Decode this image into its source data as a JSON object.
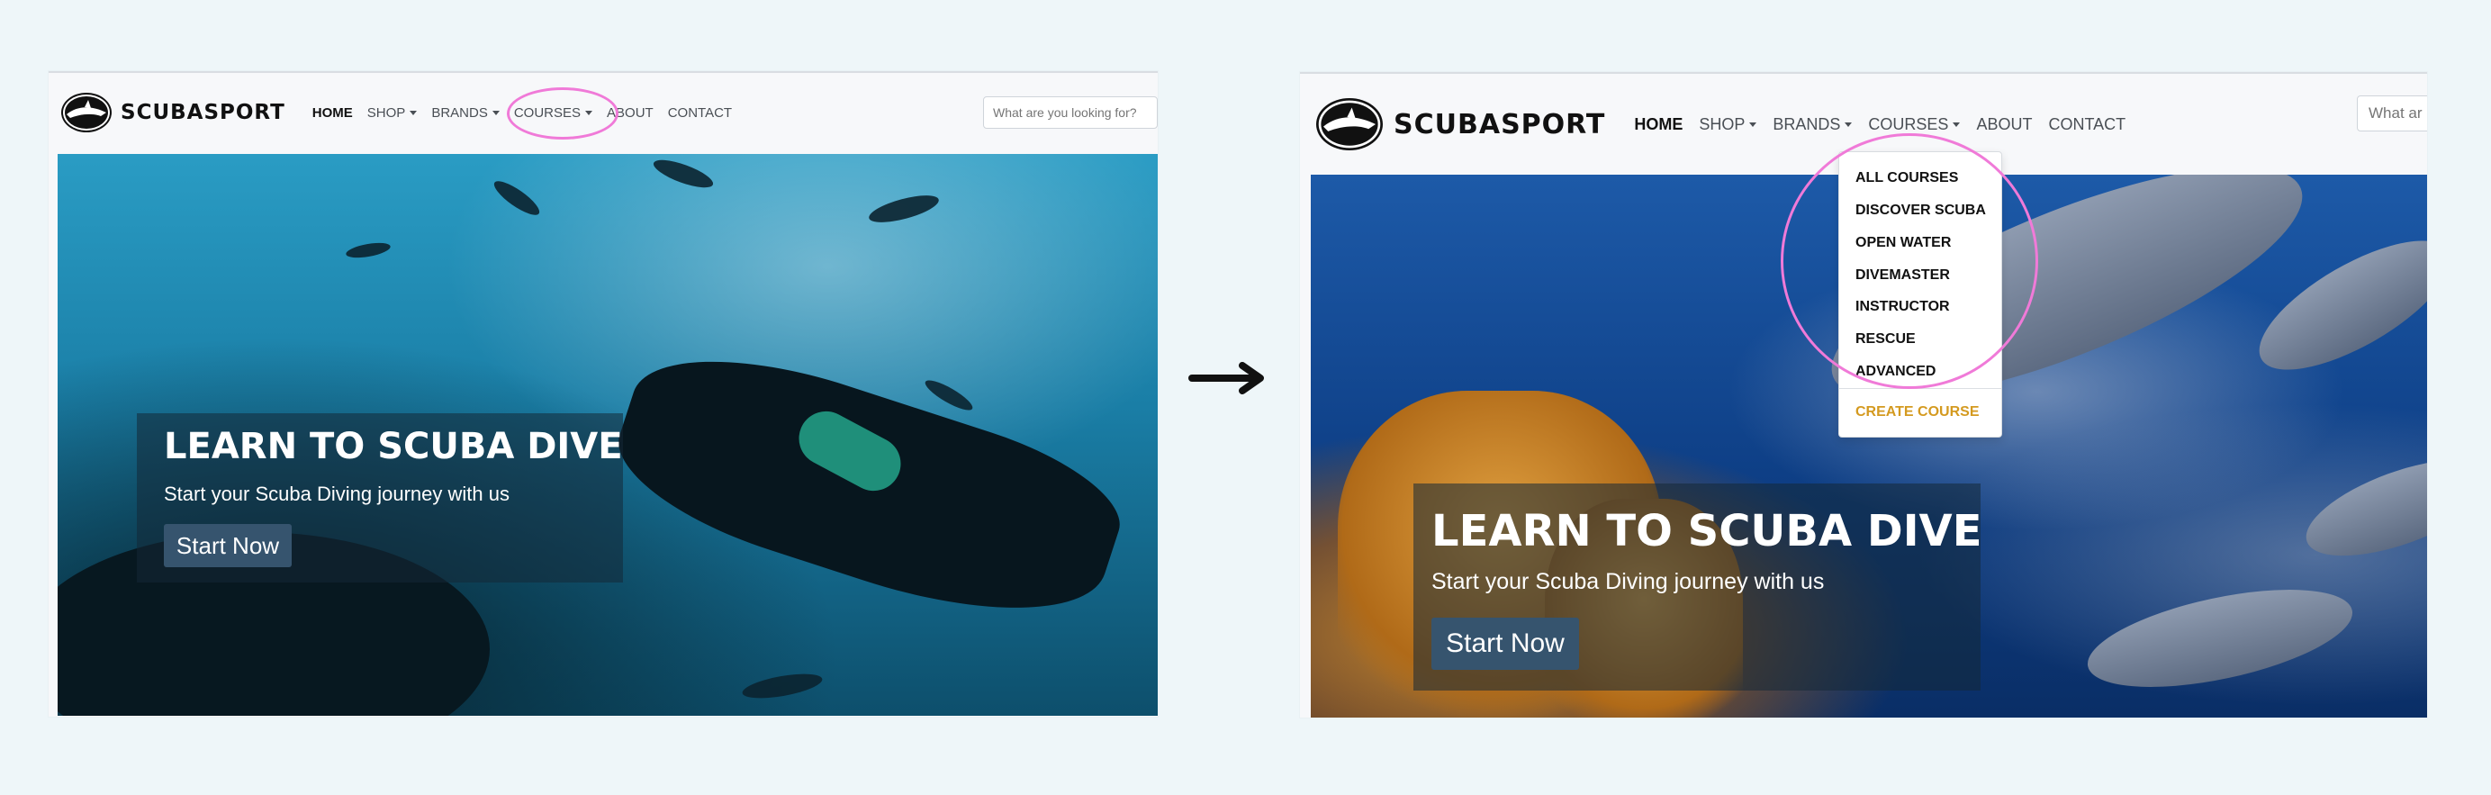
{
  "brand": {
    "name": "SCUBASPORT"
  },
  "nav": {
    "home": "HOME",
    "shop": "SHOP",
    "brands": "BRANDS",
    "courses": "COURSES",
    "about": "ABOUT",
    "contact": "CONTACT"
  },
  "search": {
    "left_placeholder": "What are you looking for?",
    "right_placeholder": "What ar"
  },
  "hero": {
    "title": "LEARN TO SCUBA DIVE",
    "subtitle": "Start your Scuba Diving journey with us",
    "button": "Start Now"
  },
  "courses_menu": {
    "items": [
      "ALL COURSES",
      "DISCOVER SCUBA",
      "OPEN WATER",
      "DIVEMASTER",
      "INSTRUCTOR",
      "RESCUE",
      "ADVANCED"
    ],
    "create": "CREATE COURSE"
  },
  "colors": {
    "highlight": "#f07ad8",
    "create_link": "#d49a20",
    "hero_button": "#36546e"
  }
}
